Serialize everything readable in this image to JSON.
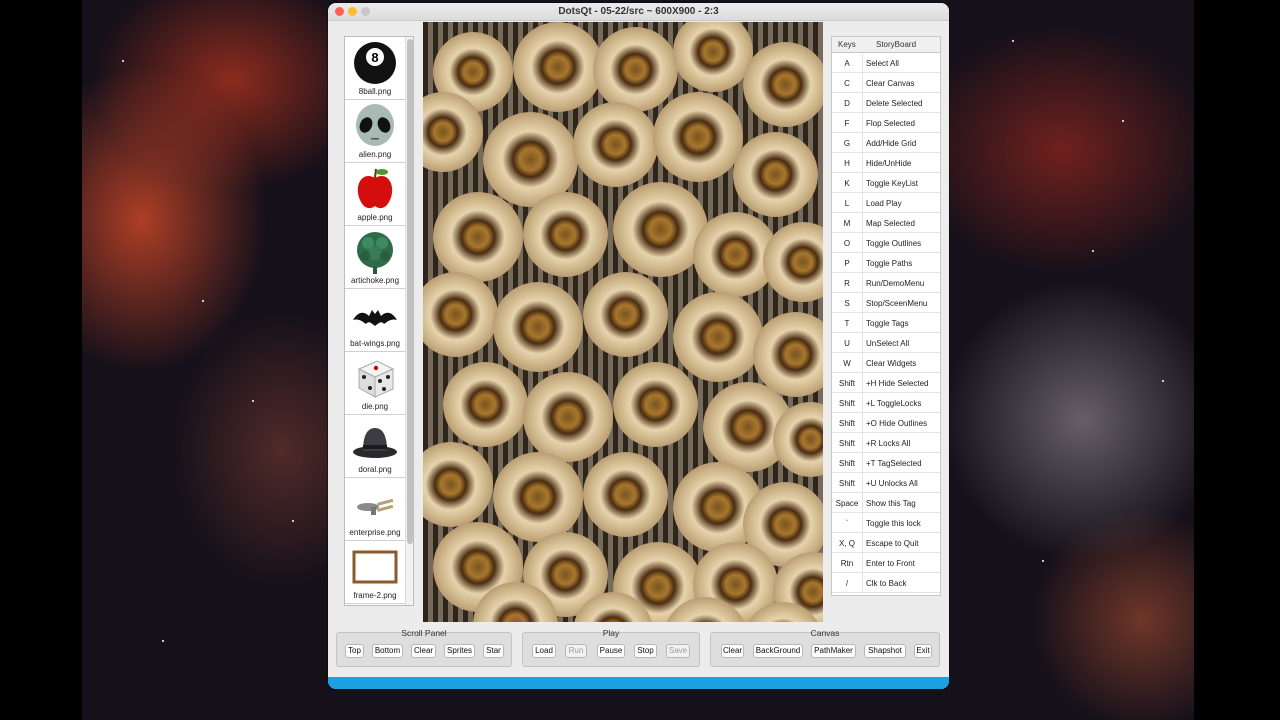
{
  "window": {
    "title": "DotsQt - 05-22/src ~ 600X900  -  2:3"
  },
  "sprites": [
    {
      "label": "8ball.png",
      "icon": "8ball-icon"
    },
    {
      "label": "alien.png",
      "icon": "alien-icon"
    },
    {
      "label": "apple.png",
      "icon": "apple-icon"
    },
    {
      "label": "artichoke.png",
      "icon": "artichoke-icon"
    },
    {
      "label": "bat-wings.png",
      "icon": "bat-icon"
    },
    {
      "label": "die.png",
      "icon": "die-icon"
    },
    {
      "label": "doral.png",
      "icon": "hat-icon"
    },
    {
      "label": "enterprise.png",
      "icon": "starship-icon"
    },
    {
      "label": "frame-2.png",
      "icon": "frame-icon"
    }
  ],
  "keys": {
    "header": {
      "keys": "Keys",
      "storyboard": "StoryBoard"
    },
    "rows": [
      {
        "key": "A",
        "action": "Select All"
      },
      {
        "key": "C",
        "action": "Clear Canvas"
      },
      {
        "key": "D",
        "action": "Delete Selected"
      },
      {
        "key": "F",
        "action": "Flop Selected"
      },
      {
        "key": "G",
        "action": "Add/Hide Grid"
      },
      {
        "key": "H",
        "action": "Hide/UnHide"
      },
      {
        "key": "K",
        "action": "Toggle KeyList"
      },
      {
        "key": "L",
        "action": "Load Play"
      },
      {
        "key": "M",
        "action": "Map Selected"
      },
      {
        "key": "O",
        "action": "Toggle Outlines"
      },
      {
        "key": "P",
        "action": "Toggle Paths"
      },
      {
        "key": "R",
        "action": "Run/DemoMenu"
      },
      {
        "key": "S",
        "action": "Stop/SceenMenu"
      },
      {
        "key": "T",
        "action": "Toggle Tags"
      },
      {
        "key": "U",
        "action": "UnSelect All"
      },
      {
        "key": "W",
        "action": "Clear Widgets"
      },
      {
        "key": "Shift",
        "action": "+H Hide Selected"
      },
      {
        "key": "Shift",
        "action": "+L ToggleLocks"
      },
      {
        "key": "Shift",
        "action": "+O Hide Outlines"
      },
      {
        "key": "Shift",
        "action": "+R Locks All"
      },
      {
        "key": "Shift",
        "action": "+T TagSelected"
      },
      {
        "key": "Shift",
        "action": "+U Unlocks All"
      },
      {
        "key": "Space",
        "action": "Show this Tag"
      },
      {
        "key": "`",
        "action": "Toggle this lock"
      },
      {
        "key": "X, Q",
        "action": "Escape to Quit"
      },
      {
        "key": "Rtn",
        "action": "Enter to Front"
      },
      {
        "key": "/",
        "action": "Clk to Back"
      }
    ]
  },
  "scroll_panel": {
    "label": "Scroll Panel",
    "buttons": {
      "top": "Top",
      "bottom": "Bottom",
      "clear": "Clear",
      "sprites": "Sprites",
      "star": "Star"
    }
  },
  "play": {
    "label": "Play",
    "buttons": {
      "load": "Load",
      "run": "Run",
      "pause": "Pause",
      "stop": "Stop",
      "save": "Save"
    }
  },
  "canvas_group": {
    "label": "Canvas",
    "buttons": {
      "clear": "Clear",
      "background": "BackGround",
      "pathmaker": "PathMaker",
      "snapshot": "Shapshot",
      "exit": "Exit"
    }
  },
  "colors": {
    "accent_bar": "#1ba1e2",
    "close": "#fe5f57",
    "minimize": "#febc2e"
  }
}
